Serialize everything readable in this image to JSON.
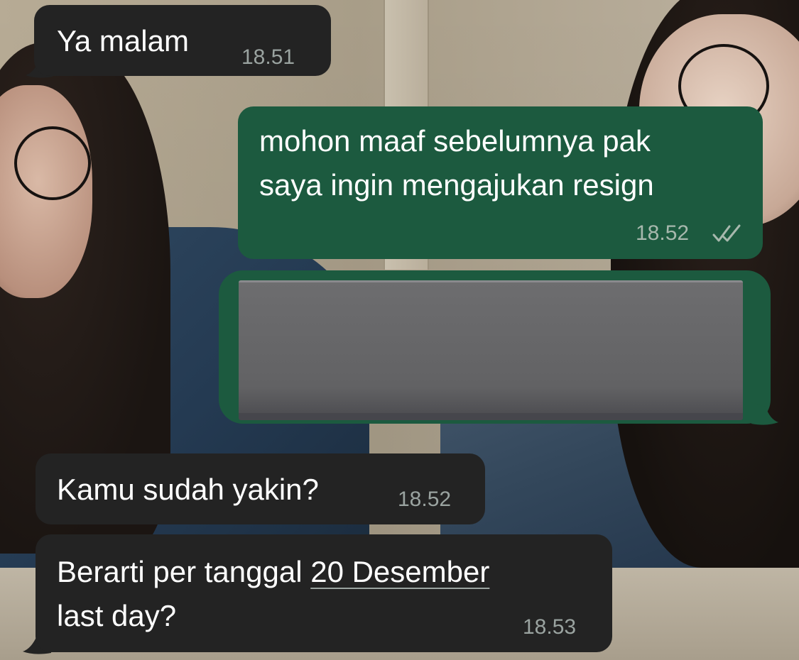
{
  "messages": [
    {
      "direction": "incoming",
      "text": "Ya malam",
      "time": "18.51"
    },
    {
      "direction": "outgoing",
      "lines": [
        "mohon maaf sebelumnya pak",
        "saya ingin mengajukan resign"
      ],
      "time": "18.52",
      "status_icon": "double-check-icon"
    },
    {
      "direction": "outgoing",
      "content": "redacted-block"
    },
    {
      "direction": "incoming",
      "text": "Kamu sudah yakin?",
      "time": "18.52"
    },
    {
      "direction": "incoming",
      "text_before_link": "Berarti per tanggal ",
      "link_text": "20 Desember",
      "text_after_link": "last day?",
      "time": "18.53"
    }
  ],
  "colors": {
    "incoming_bubble": "#232323",
    "outgoing_bubble": "#1c5a3f",
    "timestamp": "#9aa3a0"
  }
}
